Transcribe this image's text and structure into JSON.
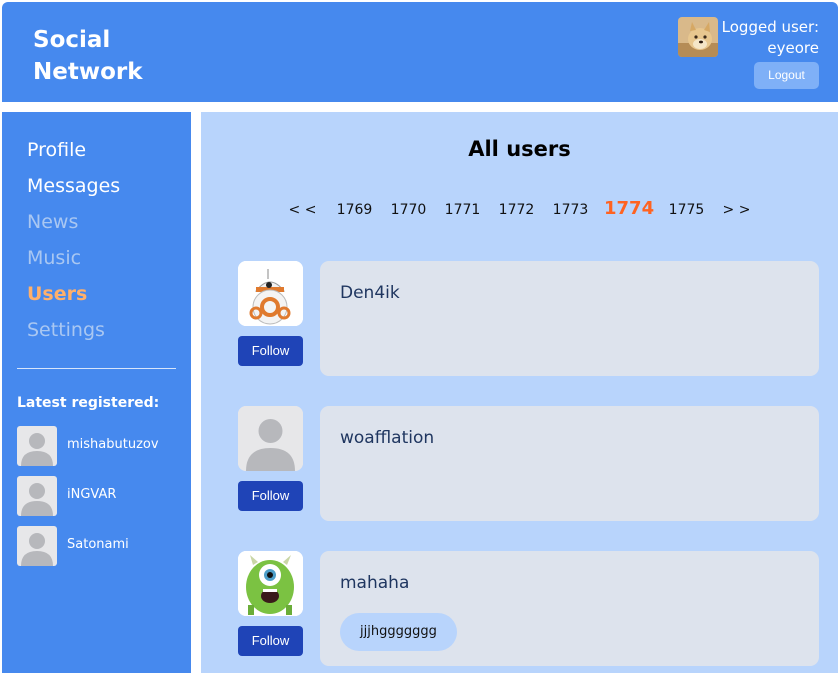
{
  "header": {
    "logo_line1": "Social",
    "logo_line2": "Network",
    "logged_label": "Logged user:",
    "username": "eyeore",
    "logout_label": "Logout"
  },
  "sidebar": {
    "items": [
      {
        "label": "Profile"
      },
      {
        "label": "Messages"
      },
      {
        "label": "News"
      },
      {
        "label": "Music"
      },
      {
        "label": "Users"
      },
      {
        "label": "Settings"
      }
    ],
    "latest_title": "Latest registered:",
    "latest": [
      {
        "name": "mishabutuzov"
      },
      {
        "name": "iNGVAR"
      },
      {
        "name": "Satonami"
      }
    ]
  },
  "main": {
    "title": "All users",
    "pagination": {
      "prev": "< <",
      "pages": [
        "1769",
        "1770",
        "1771",
        "1772",
        "1773",
        "1774",
        "1775"
      ],
      "current": "1774",
      "next": "> >"
    },
    "users": [
      {
        "name": "Den4ik",
        "follow_label": "Follow",
        "status": "",
        "avatar": "bb8-robot-icon"
      },
      {
        "name": "woafflation",
        "follow_label": "Follow",
        "status": "",
        "avatar": "default-user-icon"
      },
      {
        "name": "mahaha",
        "follow_label": "Follow",
        "status": "jjjhggggggg",
        "avatar": "green-monster-icon"
      }
    ]
  },
  "colors": {
    "primary": "#4689ee",
    "content_bg": "#b8d4fc",
    "card_bg": "#dde3ed",
    "button": "#1f44b7",
    "active_nav": "#ffb06b",
    "current_page": "#ff6321"
  }
}
